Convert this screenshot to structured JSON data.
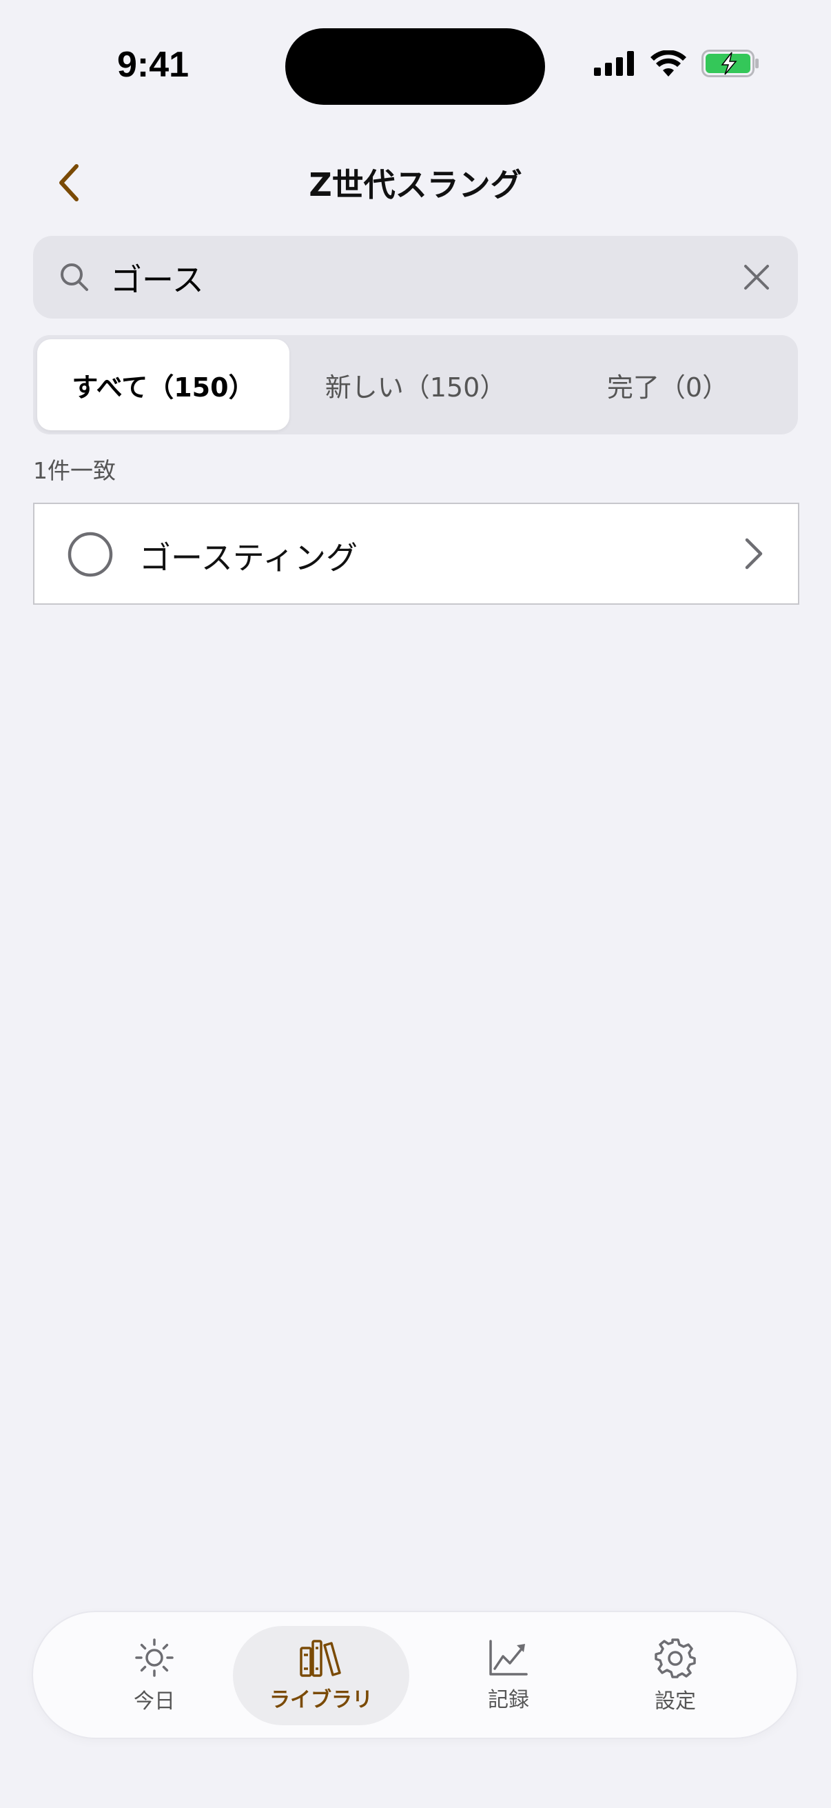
{
  "status_bar": {
    "time": "9:41"
  },
  "header": {
    "title": "Z世代スラング"
  },
  "search": {
    "value": "ゴース",
    "placeholder": ""
  },
  "segments": [
    {
      "label": "すべて（150）",
      "active": true
    },
    {
      "label": "新しい（150）",
      "active": false
    },
    {
      "label": "完了（0）",
      "active": false
    }
  ],
  "results": {
    "count_label": "1件一致",
    "items": [
      {
        "label": "ゴースティング",
        "completed": false
      }
    ]
  },
  "tab_bar": {
    "items": [
      {
        "label": "今日",
        "icon": "sun-icon",
        "active": false
      },
      {
        "label": "ライブラリ",
        "icon": "books-icon",
        "active": true
      },
      {
        "label": "記録",
        "icon": "chart-icon",
        "active": false
      },
      {
        "label": "設定",
        "icon": "gear-icon",
        "active": false
      }
    ]
  },
  "colors": {
    "accent": "#7a4a05",
    "background": "#f2f2f7",
    "battery_green": "#34c759"
  }
}
